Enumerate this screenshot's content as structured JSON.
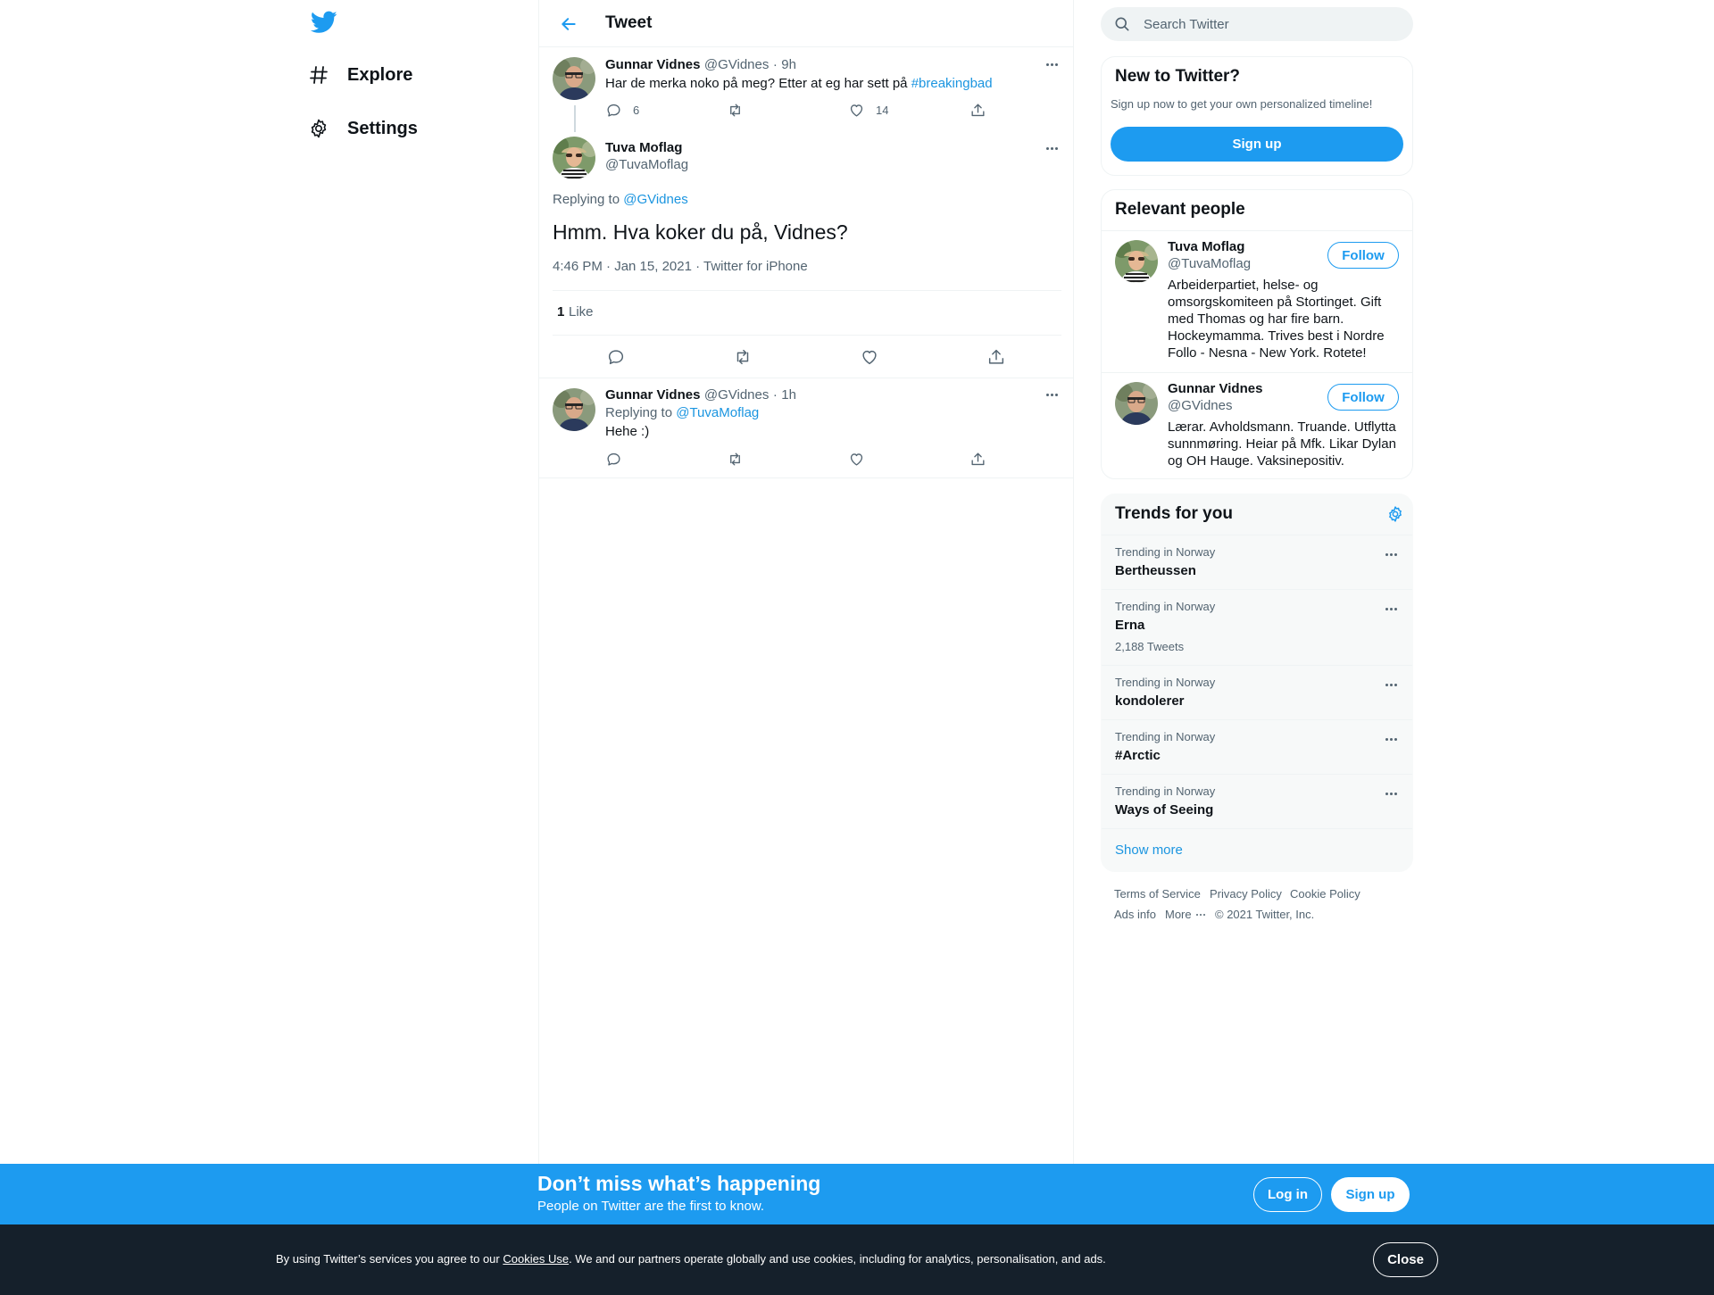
{
  "nav": {
    "logo_icon": "twitter-bird-icon",
    "items": [
      {
        "label": "Explore",
        "icon": "hashtag-icon"
      },
      {
        "label": "Settings",
        "icon": "gear-icon"
      }
    ]
  },
  "header": {
    "title": "Tweet",
    "back_icon": "arrow-left-icon"
  },
  "parent_tweet": {
    "name": "Gunnar Vidnes",
    "handle": "@GVidnes",
    "separator": "·",
    "time": "9h",
    "text": "Har de merka noko på meg? Etter at eg har sett på ",
    "hashtag": "#breakingbad",
    "reply_count": "6",
    "like_count": "14"
  },
  "main_tweet": {
    "name": "Tuva Moflag",
    "handle": "@TuvaMoflag",
    "replying_prefix": "Replying to ",
    "replying_to": "@GVidnes",
    "text": "Hmm. Hva koker du på, Vidnes?",
    "meta": "4:46 PM · Jan 15, 2021 · Twitter for iPhone",
    "likes_count": "1",
    "likes_label": "Like"
  },
  "reply_tweet": {
    "name": "Gunnar Vidnes",
    "handle": "@GVidnes",
    "separator": "·",
    "time": "1h",
    "replying_prefix": "Replying to ",
    "replying_to": "@TuvaMoflag",
    "text": "Hehe :)"
  },
  "search": {
    "placeholder": "Search Twitter"
  },
  "new_to_twitter": {
    "title": "New to Twitter?",
    "subtitle": "Sign up now to get your own personalized timeline!",
    "button": "Sign up"
  },
  "relevant_people": {
    "title": "Relevant people",
    "follow_label": "Follow",
    "people": [
      {
        "name": "Tuva Moflag",
        "handle": "@TuvaMoflag",
        "bio": "Arbeiderpartiet, helse- og omsorgskomiteen på Stortinget. Gift med Thomas og har fire barn. Hockeymamma. Trives best i Nordre Follo - Nesna - New York. Rotete!"
      },
      {
        "name": "Gunnar Vidnes",
        "handle": "@GVidnes",
        "bio": "Lærar. Avholdsmann. Truande. Utflytta sunnmøring. Heiar på Mfk. Likar Dylan og OH Hauge. Vaksinepositiv."
      }
    ]
  },
  "trends": {
    "title": "Trends for you",
    "items": [
      {
        "context": "Trending in Norway",
        "name": "Bertheussen",
        "count": ""
      },
      {
        "context": "Trending in Norway",
        "name": "Erna",
        "count": "2,188 Tweets"
      },
      {
        "context": "Trending in Norway",
        "name": "kondolerer",
        "count": ""
      },
      {
        "context": "Trending in Norway",
        "name": "#Arctic",
        "count": ""
      },
      {
        "context": "Trending in Norway",
        "name": "Ways of Seeing",
        "count": ""
      }
    ],
    "show_more": "Show more"
  },
  "footer": {
    "links": [
      "Terms of Service",
      "Privacy Policy",
      "Cookie Policy",
      "Ads info",
      "More"
    ],
    "copyright": "© 2021 Twitter, Inc."
  },
  "signup_bar": {
    "headline": "Don’t miss what’s happening",
    "subline": "People on Twitter are the first to know.",
    "login": "Log in",
    "signup": "Sign up"
  },
  "cookie_bar": {
    "text_before": "By using Twitter’s services you agree to our ",
    "link": "Cookies Use",
    "text_after": ". We and our partners operate globally and use cookies, including for analytics, personalisation, and ads.",
    "close": "Close"
  },
  "colors": {
    "accent": "#1d9bf0",
    "link": "#1b95e0",
    "text": "#0f1419",
    "secondary": "#536471",
    "cookie_bg": "#15202b"
  }
}
